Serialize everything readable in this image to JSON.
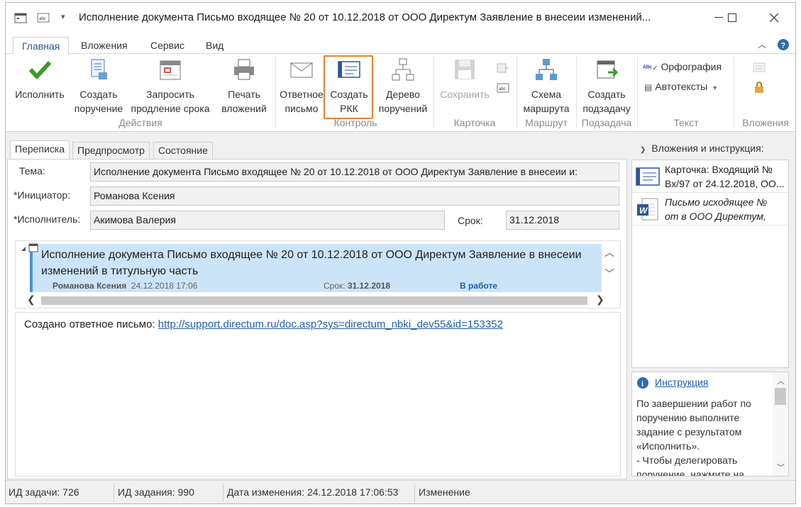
{
  "window": {
    "title": "Исполнение документа Письмо входящее № 20 от 10.12.2018 от ООО Директум Заявление в внесеии изменений..."
  },
  "ribbon_tabs": {
    "home": "Главная",
    "attachments": "Вложения",
    "service": "Сервис",
    "view": "Вид"
  },
  "ribbon": {
    "execute": "Исполнить",
    "create_order_1": "Создать",
    "create_order_2": "поручение",
    "request_ext_1": "Запросить",
    "request_ext_2": "продление срока",
    "print_1": "Печать",
    "print_2": "вложений",
    "group_actions": "Действия",
    "reply_1": "Ответное",
    "reply_2": "письмо",
    "create_rkk_1": "Создать",
    "create_rkk_2": "РКК",
    "tree_1": "Дерево",
    "tree_2": "поручений",
    "group_control": "Контроль",
    "save": "Сохранить",
    "group_card": "Карточка",
    "route_1": "Схема",
    "route_2": "маршрута",
    "group_route": "Маршрут",
    "subtask_1": "Создать",
    "subtask_2": "подзадачу",
    "group_subtask": "Подзадача",
    "spelling": "Орфография",
    "autotext": "Автотексты",
    "group_text": "Текст",
    "group_attachments": "Вложения"
  },
  "subtabs": {
    "correspondence": "Переписка",
    "preview": "Предпросмотр",
    "state": "Состояние"
  },
  "form": {
    "subject_label": "Тема:",
    "subject_value": "Исполнение документа Письмо входящее № 20 от 10.12.2018 от ООО Директум Заявление в внесеии и:",
    "initiator_label": "*Инициатор:",
    "initiator_value": "Романова Ксения",
    "executor_label": "*Исполнитель:",
    "executor_value": "Акимова Валерия",
    "deadline_label": "Срок:",
    "deadline_value": "31.12.2018"
  },
  "thread": {
    "title": "Исполнение документа Письмо входящее № 20 от 10.12.2018 от ООО Директум Заявление в внесеии изменений в титульную часть",
    "author": "Романова Ксения",
    "date": "24.12.2018 17:06",
    "deadline_label": "Срок:",
    "deadline": "31.12.2018",
    "status": "В работе"
  },
  "message": {
    "text": "Создано ответное письмо: ",
    "link": "http://support.directum.ru/doc.asp?sys=directum_nbki_dev55&id=153352"
  },
  "right_pane": {
    "header": "Вложения и инструкция:",
    "attachments": [
      {
        "line1": "Карточка: Входящий №",
        "line2": "Вх/97 от 24.12.2018, ОО..."
      },
      {
        "line1": "Письмо исходящее №",
        "line2": "от  в ООО Директум,"
      }
    ],
    "instruction_link": "Инструкция",
    "instruction_text": "По завершении работ по поручению выполните задание с результатом «Исполнить».\n- Чтобы делегировать поручение, нажмите на"
  },
  "status_bar": {
    "task_id": "ИД задачи: 726",
    "assignment_id": "ИД задания: 990",
    "modified": "Дата изменения: 24.12.2018 17:06:53",
    "state": "Изменение"
  },
  "colors": {
    "accent": "#2b579a",
    "highlight": "#e8832a",
    "thread_bg": "#cce4f7",
    "status_in_work": "#1f5fa8"
  }
}
